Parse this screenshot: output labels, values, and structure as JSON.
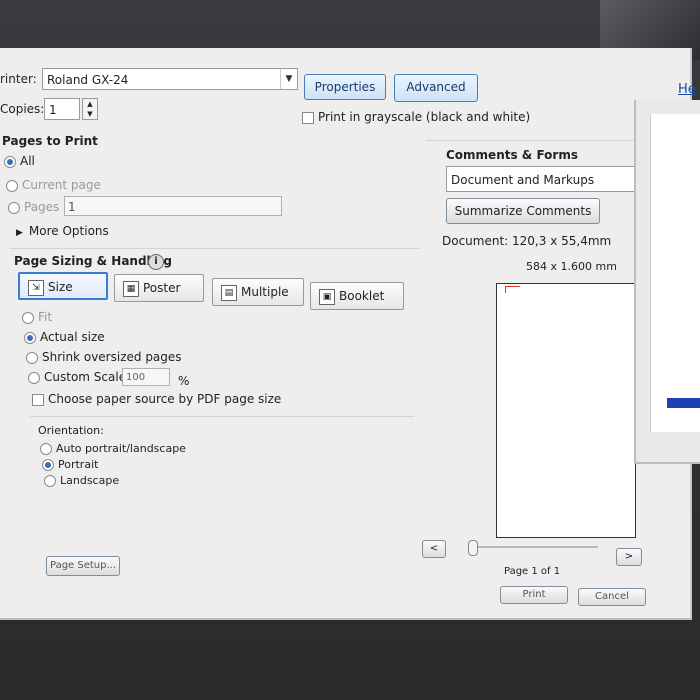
{
  "printer": {
    "label": "rinter:",
    "value": "Roland GX-24"
  },
  "copies": {
    "label": "Copies:",
    "value": "1"
  },
  "header_buttons": {
    "properties": "Properties",
    "advanced": "Advanced",
    "help": "He"
  },
  "grayscale": {
    "label": "Print in grayscale (black and white)",
    "checked": false
  },
  "pages_to_print": {
    "title": "Pages to Print",
    "all": "All",
    "current": "Current page",
    "pages": "Pages",
    "pages_value": "1",
    "more": "More Options"
  },
  "sizing": {
    "title": "Page Sizing & Handling",
    "info_icon": "i",
    "size": "Size",
    "poster": "Poster",
    "multiple": "Multiple",
    "booklet": "Booklet",
    "fit": "Fit",
    "actual": "Actual size",
    "shrink": "Shrink oversized pages",
    "custom": "Custom Scale:",
    "custom_value": "100",
    "custom_unit": "%",
    "paper_source": "Choose paper source by PDF page size"
  },
  "orientation": {
    "title": "Orientation:",
    "auto": "Auto portrait/landscape",
    "portrait": "Portrait",
    "landscape": "Landscape",
    "selected": "portrait"
  },
  "page_setup": "Page Setup...",
  "comments": {
    "title": "Comments & Forms",
    "value": "Document and Markups",
    "summarize": "Summarize Comments",
    "document_size": "Document: 120,3 x 55,4mm",
    "paper_size": "584 x 1.600 mm"
  },
  "nav": {
    "prev": "<",
    "next": ">",
    "page_info": "Page 1 of 1"
  },
  "actions": {
    "print": "Print",
    "cancel": "Cancel"
  },
  "colors": {
    "accent": "#3c7bd4",
    "dialog": "#eeeeee"
  }
}
